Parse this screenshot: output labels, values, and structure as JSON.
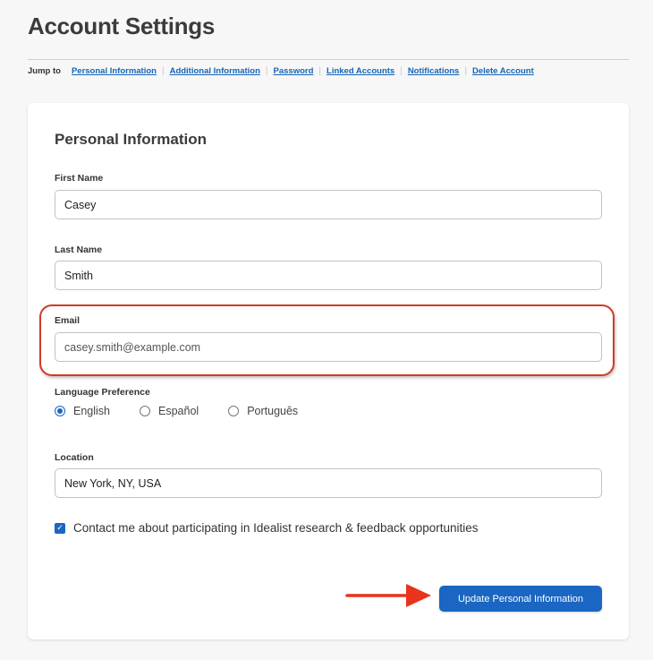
{
  "page": {
    "title": "Account Settings"
  },
  "jump_nav": {
    "label": "Jump to",
    "links": [
      {
        "label": "Personal Information"
      },
      {
        "label": "Additional Information"
      },
      {
        "label": "Password"
      },
      {
        "label": "Linked Accounts"
      },
      {
        "label": "Notifications"
      },
      {
        "label": "Delete Account"
      }
    ]
  },
  "personal_info": {
    "section_title": "Personal Information",
    "first_name": {
      "label": "First Name",
      "value": "Casey"
    },
    "last_name": {
      "label": "Last Name",
      "value": "Smith"
    },
    "email": {
      "label": "Email",
      "value": "casey.smith@example.com"
    },
    "language": {
      "label": "Language Preference",
      "options": [
        {
          "label": "English",
          "checked": true
        },
        {
          "label": "Español",
          "checked": false
        },
        {
          "label": "Português",
          "checked": false
        }
      ],
      "selected": "English"
    },
    "location": {
      "label": "Location",
      "value": "New York, NY, USA"
    },
    "contact_opt_in": {
      "label": "Contact me about participating in Idealist research & feedback opportunities",
      "checked": true,
      "check_glyph": "✓"
    },
    "submit_label": "Update Personal Information"
  },
  "annotations": {
    "highlight_color": "#d23a25",
    "arrow_color": "#e8341c",
    "highlighted_field": "Email",
    "arrow_target": "Update Personal Information"
  },
  "colors": {
    "accent": "#1a66c2",
    "link": "#1565b6",
    "background": "#f7f7f7",
    "card": "#ffffff"
  }
}
